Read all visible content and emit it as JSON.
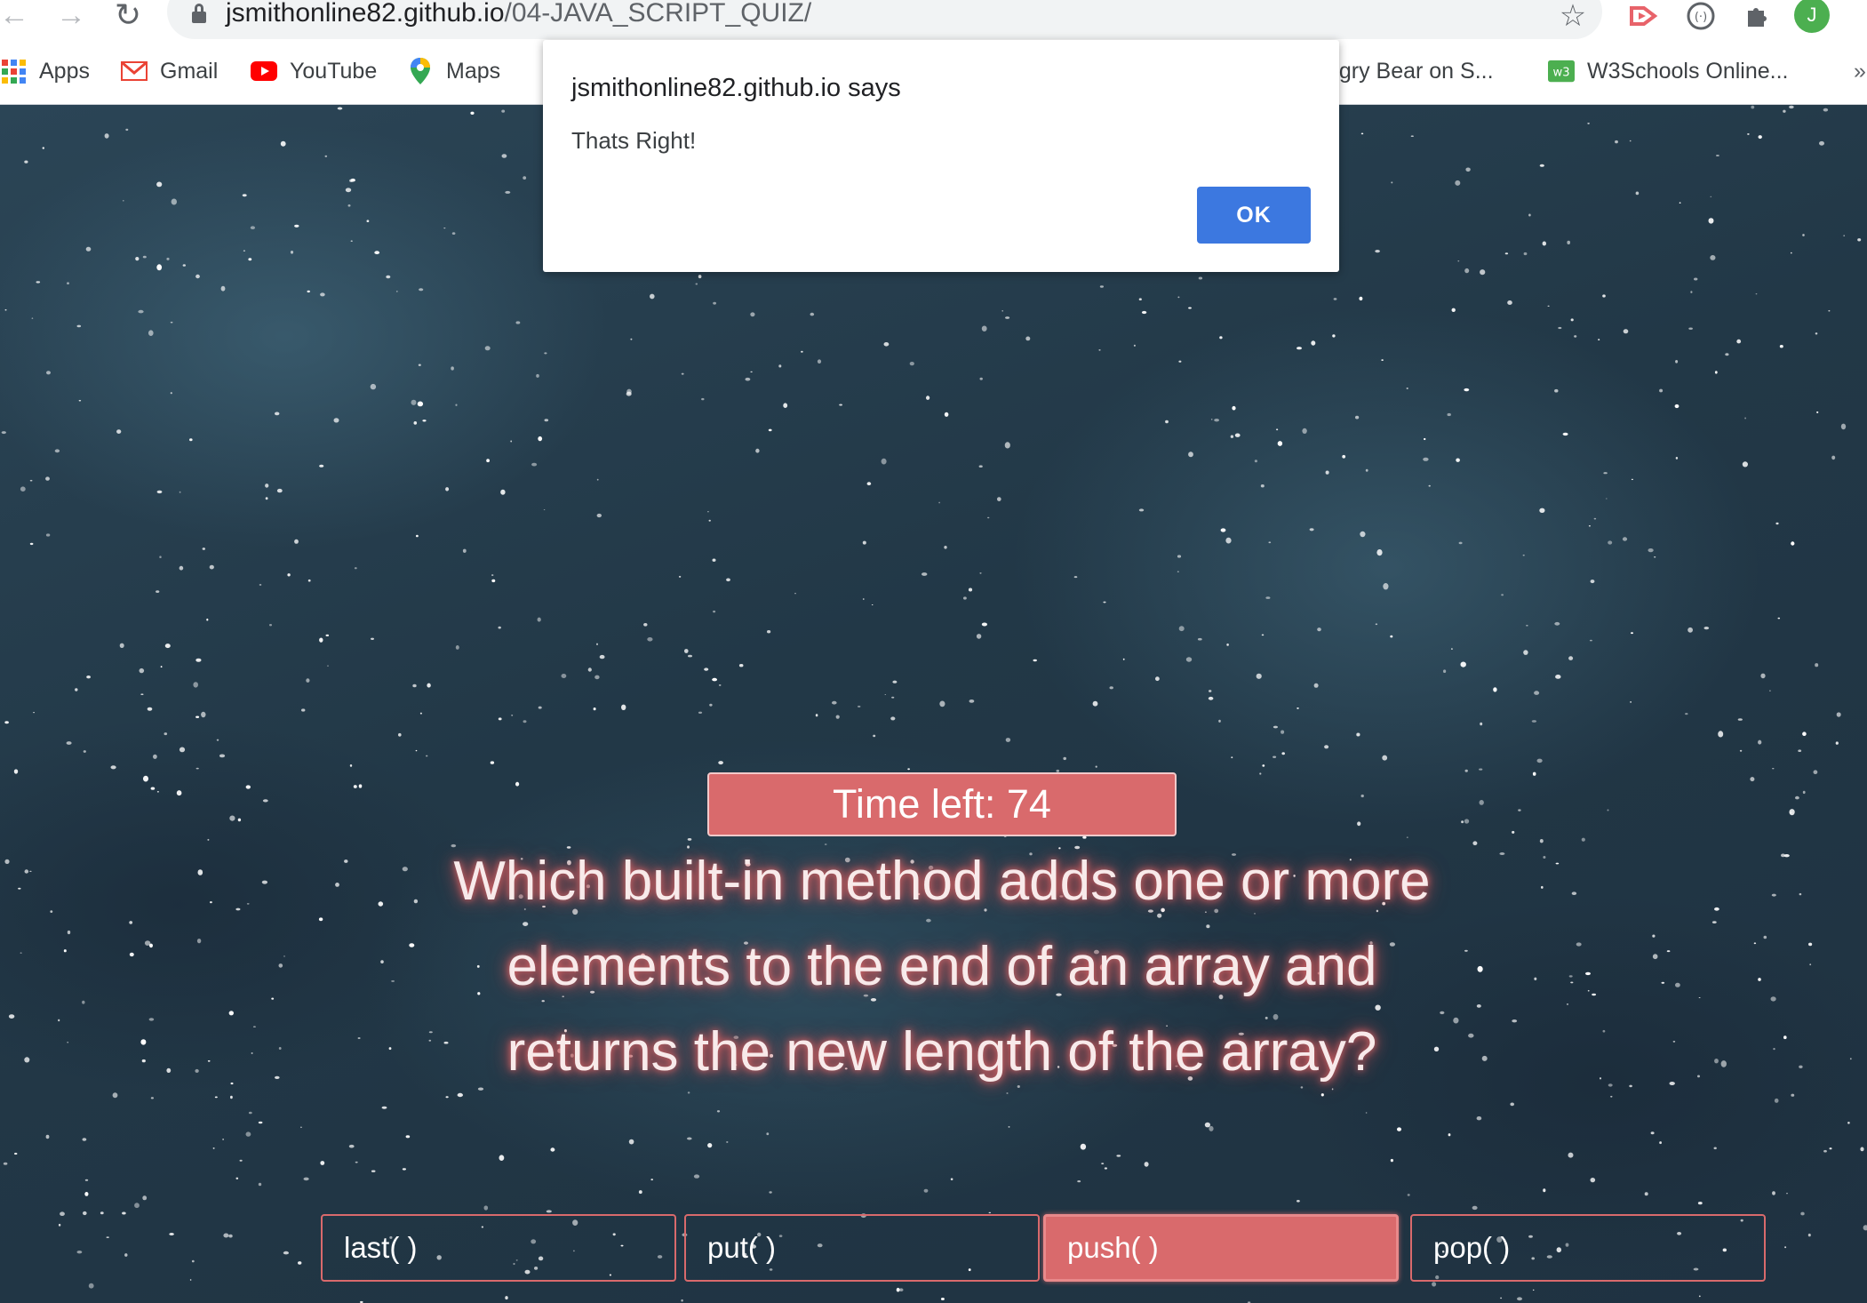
{
  "browser": {
    "url_host": "jsmithonline82.github.io",
    "url_path": "/04-JAVA_SCRIPT_QUIZ/",
    "profile_initial": "J",
    "bookmarks": [
      {
        "label": "Apps",
        "icon": "apps-grid-icon"
      },
      {
        "label": "Gmail",
        "icon": "gmail-icon"
      },
      {
        "label": "YouTube",
        "icon": "youtube-icon"
      },
      {
        "label": "Maps",
        "icon": "maps-pin-icon"
      },
      {
        "label": "ıngry Bear on S...",
        "icon": ""
      },
      {
        "label": "W3Schools Online...",
        "icon": "w3schools-icon"
      }
    ],
    "overflow": "»"
  },
  "dialog": {
    "title": "jsmithonline82.github.io says",
    "message": "Thats Right!",
    "ok_label": "OK"
  },
  "quiz": {
    "timer_text": "Time left: 74",
    "question": "Which built-in method adds one or more elements to the end of an array and returns the new length of the array?",
    "answers": [
      "last( )",
      "put( )",
      "push( )",
      "pop( )"
    ],
    "selected_answer": "push( )",
    "accent_color": "#d96a6c"
  }
}
